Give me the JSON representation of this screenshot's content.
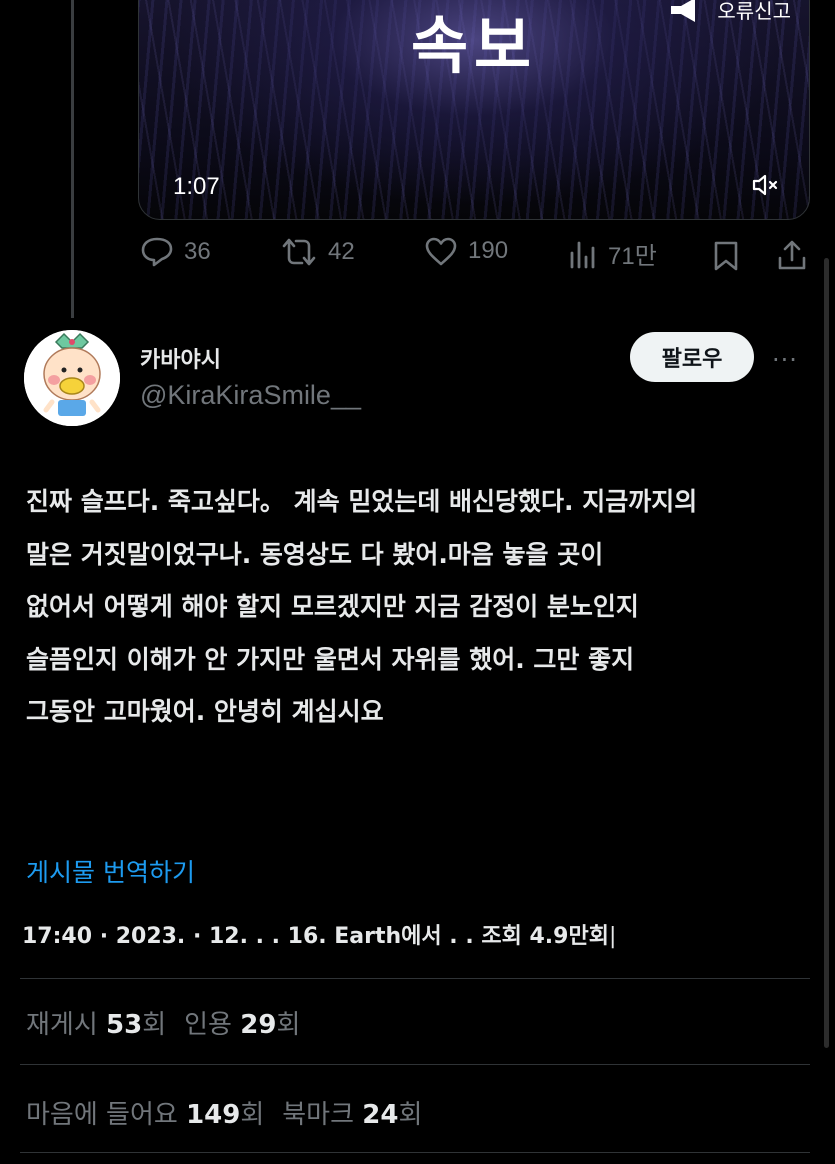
{
  "video": {
    "title_text": "속보",
    "report_label": "오류신고",
    "duration": "1:07",
    "icons": [
      "megaphone-icon",
      "mute-icon"
    ]
  },
  "actions": {
    "replies": "36",
    "reposts": "42",
    "likes": "190",
    "views": "71만",
    "icons": [
      "reply-icon",
      "repost-icon",
      "heart-icon",
      "views-icon",
      "bookmark-icon",
      "share-icon"
    ]
  },
  "author": {
    "display_name": "카바야시",
    "handle": "@KiraKiraSmile__",
    "follow_label": "팔로우",
    "more_label": "···"
  },
  "post": {
    "lines": [
      "진짜 슬프다. 죽고싶다。 계속 믿었는데 배신당했다. 지금까지의",
      "말은 거짓말이었구나. 동영상도 다 봤어.마음 놓을 곳이",
      "없어서 어떻게 해야 할지 모르겠지만 지금 감정이 분노인지",
      "슬픔인지 이해가 안 가지만 울면서 자위를 했어. 그만 좋지",
      "그동안 고마웠어. 안녕히 계십시요"
    ],
    "translate_label": "게시물 번역하기",
    "meta": "17:40 · 2023. · 12. . . 16. Earth에서 . . 조회 4.9만회"
  },
  "stats": {
    "reposts_label": "재게시",
    "reposts_count": "53",
    "quotes_label": "인용",
    "quotes_count": "29",
    "likes_label": "마음에 들어요",
    "likes_count": "149",
    "bookmarks_label": "북마크",
    "bookmarks_count": "24",
    "unit": "회"
  },
  "colors": {
    "background": "#000000",
    "text": "#e7e9ea",
    "muted": "#71767b",
    "link": "#1d9bf0",
    "divider": "#2f3336"
  }
}
